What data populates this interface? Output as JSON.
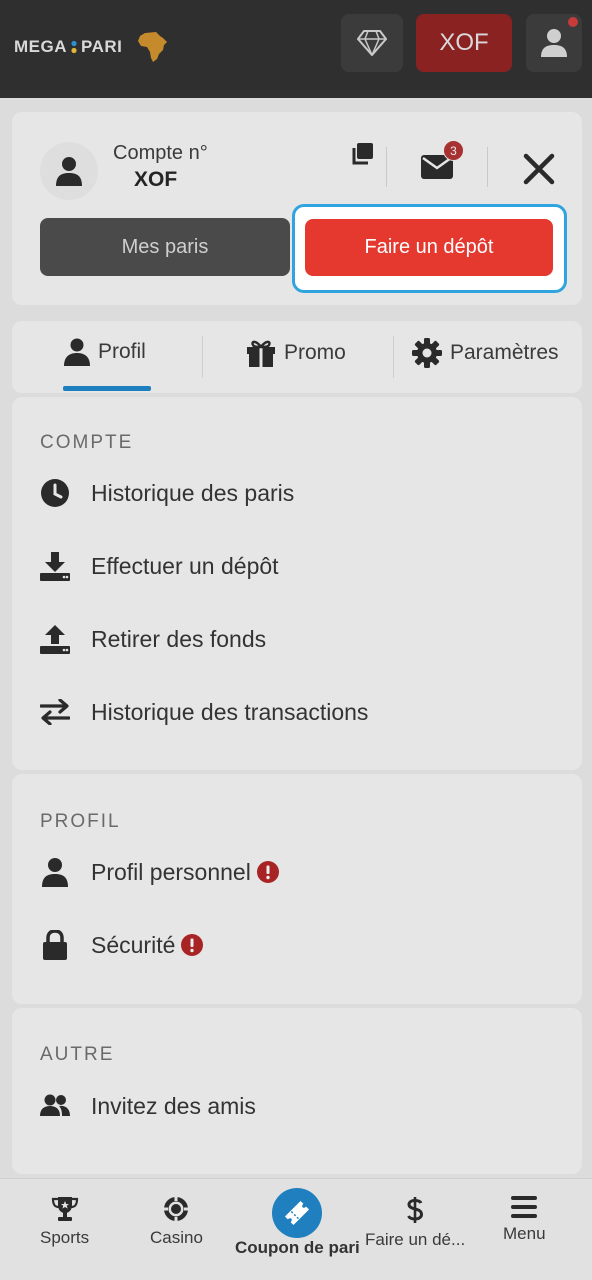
{
  "header": {
    "logo_left": "MEGA",
    "logo_right": "PARI",
    "currency_button": "XOF"
  },
  "account": {
    "label": "Compte n°",
    "currency": "XOF",
    "unread_messages": "3",
    "my_bets_label": "Mes paris",
    "deposit_label": "Faire un dépôt"
  },
  "tabs": [
    {
      "label": "Profil",
      "icon": "user-icon",
      "active": true
    },
    {
      "label": "Promo",
      "icon": "gift-icon"
    },
    {
      "label": "Paramètres",
      "icon": "gear-icon"
    }
  ],
  "sections": {
    "compte": {
      "title": "COMPTE",
      "items": [
        {
          "label": "Historique des paris",
          "icon": "clock-icon"
        },
        {
          "label": "Effectuer un dépôt",
          "icon": "download-icon"
        },
        {
          "label": "Retirer des fonds",
          "icon": "upload-icon"
        },
        {
          "label": "Historique des transactions",
          "icon": "swap-icon"
        }
      ]
    },
    "profil": {
      "title": "PROFIL",
      "items": [
        {
          "label": "Profil personnel",
          "icon": "user-icon",
          "warning": true
        },
        {
          "label": "Sécurité",
          "icon": "lock-icon",
          "warning": true
        }
      ]
    },
    "autre": {
      "title": "AUTRE",
      "items": [
        {
          "label": "Invitez des amis",
          "icon": "users-icon"
        }
      ]
    }
  },
  "bottom_nav": [
    {
      "label": "Sports",
      "icon": "trophy-icon"
    },
    {
      "label": "Casino",
      "icon": "chip-icon"
    },
    {
      "label": "Coupon de pari",
      "icon": "ticket-icon",
      "active": true
    },
    {
      "label": "Faire un dé...",
      "icon": "dollar-icon"
    },
    {
      "label": "Menu",
      "icon": "hamburger-icon"
    }
  ],
  "colors": {
    "accent_red": "#e5392f",
    "accent_blue": "#1f7fbf",
    "highlight_border": "#2fa4df",
    "warning_red": "#a82424"
  }
}
